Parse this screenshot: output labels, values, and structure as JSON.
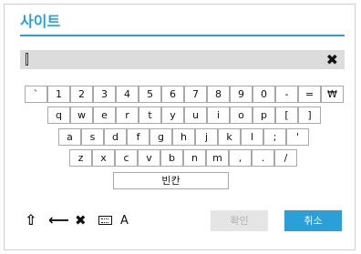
{
  "dialog": {
    "title": "사이트"
  },
  "input": {
    "value": "",
    "clear_icon": "✖"
  },
  "keyboard": {
    "row1": [
      "`",
      "1",
      "2",
      "3",
      "4",
      "5",
      "6",
      "7",
      "8",
      "9",
      "0",
      "-",
      "=",
      "₩"
    ],
    "row2": [
      "q",
      "w",
      "e",
      "r",
      "t",
      "y",
      "u",
      "i",
      "o",
      "p",
      "[",
      "]"
    ],
    "row3": [
      "a",
      "s",
      "d",
      "f",
      "g",
      "h",
      "j",
      "k",
      "l",
      ";",
      "'"
    ],
    "row4": [
      "z",
      "x",
      "c",
      "v",
      "b",
      "n",
      "m",
      ",",
      ".",
      "/"
    ],
    "space_label": "빈칸"
  },
  "toolbar": {
    "shift_icon": "⇧",
    "backspace_icon": "⟵",
    "clear_icon": "✖",
    "mode_label": "A"
  },
  "buttons": {
    "ok_label": "확인",
    "cancel_label": "취소"
  },
  "colors": {
    "accent": "#2a9fd8",
    "input_bg": "#dcdcdc",
    "ok_disabled_bg": "#e5e5e5"
  }
}
